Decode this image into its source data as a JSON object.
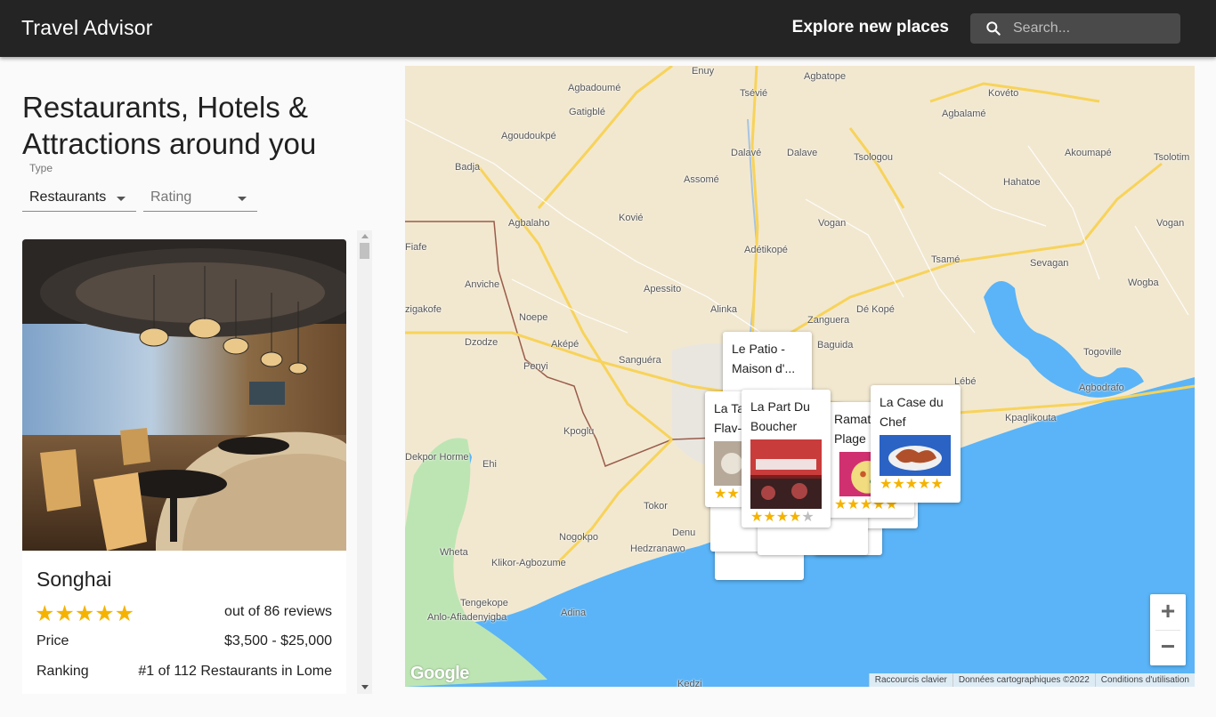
{
  "appbar": {
    "title": "Travel Advisor",
    "explore": "Explore new places",
    "search_placeholder": "Search..."
  },
  "left": {
    "heading": "Restaurants, Hotels & Attractions around you",
    "type_label": "Type",
    "type_value": "Restaurants",
    "rating_placeholder": "Rating"
  },
  "card": {
    "name": "Songhai",
    "stars": "★★★★★",
    "rating": 5,
    "reviews": "out of 86 reviews",
    "price_label": "Price",
    "price_value": "$3,500 - $25,000",
    "ranking_label": "Ranking",
    "ranking_value": "#1 of 112 Restaurants in Lome"
  },
  "map": {
    "places": [
      "Enuy",
      "Agbatope",
      "Agbadoumé",
      "Tsévié",
      "Kovéto",
      "Gatigblé",
      "Agbalamé",
      "Agoudoukpé",
      "Dalavé",
      "Dalave",
      "Tsologou",
      "Akoumapé",
      "Badja",
      "Assomé",
      "Hahatoe",
      "Tsolotim",
      "Agbalaho",
      "Kovié",
      "Vogan",
      "Vogan",
      "Fiafe",
      "Adétikopé",
      "Tsamé",
      "Sevagan",
      "Anviche",
      "Apessito",
      "Wogba",
      "zigakofe",
      "Alinka",
      "Dé Kopé",
      "Noepe",
      "Dzodze",
      "Aképé",
      "Zanguera",
      "Baguida",
      "Togoville",
      "Penyi",
      "Sanguéra",
      "Lébé",
      "Agbodrafo",
      "Kpaglikouta",
      "Kpoglu",
      "Dekpor Horme",
      "Ehi",
      "Tokor",
      "Denu",
      "Nogokpo",
      "Hedzranawo",
      "Wheta",
      "Klikor-Agbozume",
      "Tengekope",
      "Anlo-Afiadenyigba",
      "Adina",
      "Kedzi"
    ],
    "markers": [
      {
        "name": "Le Patio - Maison d'..."
      },
      {
        "name": "La Ta... Flav-..."
      },
      {
        "name": "La Part Du Boucher",
        "stars": "★★★★",
        "off": "★"
      },
      {
        "name": "Ramat... Plage"
      },
      {
        "name": "La Case du Chef",
        "stars": "★★★★★",
        "off": ""
      }
    ],
    "zoom_in": "+",
    "zoom_out": "−",
    "logo": "Google",
    "footer": [
      "Raccourcis clavier",
      "Données cartographiques ©2022",
      "Conditions d'utilisation"
    ]
  },
  "colors": {
    "appbar": "#242424",
    "star": "#f5b300",
    "water": "#5ab4f7",
    "land": "#f2e8d0",
    "road": "#f7d35a"
  }
}
